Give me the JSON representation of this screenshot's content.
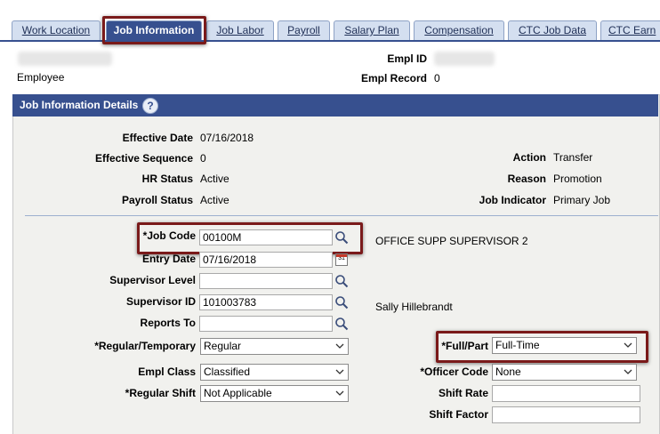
{
  "tabs": [
    {
      "label": "Work Location",
      "active": false
    },
    {
      "label": "Job Information",
      "active": true
    },
    {
      "label": "Job Labor",
      "active": false
    },
    {
      "label": "Payroll",
      "active": false
    },
    {
      "label": "Salary Plan",
      "active": false
    },
    {
      "label": "Compensation",
      "active": false
    },
    {
      "label": "CTC Job Data",
      "active": false
    },
    {
      "label": "CTC Earn",
      "active": false
    }
  ],
  "header": {
    "employee_label": "Employee",
    "empl_id_label": "Empl ID",
    "empl_record_label": "Empl Record",
    "empl_record_value": "0"
  },
  "section": {
    "title": "Job Information Details",
    "help_glyph": "?"
  },
  "details": {
    "effective_date_label": "Effective Date",
    "effective_date_value": "07/16/2018",
    "effective_sequence_label": "Effective Sequence",
    "effective_sequence_value": "0",
    "hr_status_label": "HR Status",
    "hr_status_value": "Active",
    "payroll_status_label": "Payroll Status",
    "payroll_status_value": "Active",
    "action_label": "Action",
    "action_value": "Transfer",
    "reason_label": "Reason",
    "reason_value": "Promotion",
    "job_indicator_label": "Job Indicator",
    "job_indicator_value": "Primary Job"
  },
  "form": {
    "job_code_label": "*Job Code",
    "job_code_value": "00100M",
    "job_code_description": "OFFICE SUPP SUPERVISOR 2",
    "entry_date_label": "Entry Date",
    "entry_date_value": "07/16/2018",
    "calendar_glyph": "31",
    "supervisor_level_label": "Supervisor Level",
    "supervisor_level_value": "",
    "supervisor_id_label": "Supervisor ID",
    "supervisor_id_value": "101003783",
    "supervisor_name": "Sally Hillebrandt",
    "reports_to_label": "Reports To",
    "reports_to_value": "",
    "regular_temporary_label": "*Regular/Temporary",
    "regular_temporary_value": "Regular",
    "full_part_label": "*Full/Part",
    "full_part_value": "Full-Time",
    "empl_class_label": "Empl Class",
    "empl_class_value": "Classified",
    "officer_code_label": "*Officer Code",
    "officer_code_value": "None",
    "regular_shift_label": "*Regular Shift",
    "regular_shift_value": "Not Applicable",
    "shift_rate_label": "Shift Rate",
    "shift_rate_value": "",
    "shift_factor_label": "Shift Factor",
    "shift_factor_value": ""
  },
  "colors": {
    "accent": "#37508f",
    "highlight_border": "#7a1a1a",
    "tab_inactive": "#d4dff0",
    "panel_bg": "#f1f1ee"
  }
}
